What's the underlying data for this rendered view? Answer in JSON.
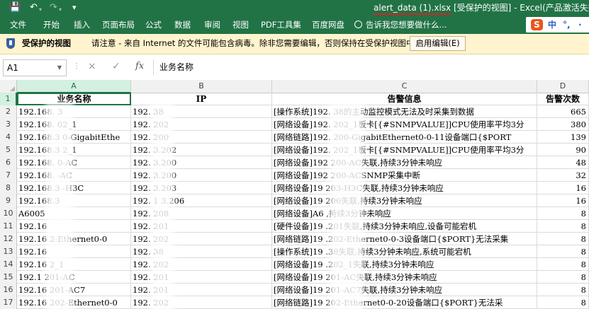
{
  "titlebar": {
    "filename": "alert_data (1).xlsx",
    "suffix": "[受保护的视图] - Excel(产品激活失败)",
    "icons": [
      "save-icon",
      "undo-icon",
      "redo-icon",
      "customize-icon"
    ]
  },
  "ribbon": {
    "tabs": [
      "文件",
      "开始",
      "插入",
      "页面布局",
      "公式",
      "数据",
      "审阅",
      "视图",
      "PDF工具集",
      "百度网盘"
    ],
    "tellme": "告诉我您想要做什么..."
  },
  "ime": {
    "logo": "S",
    "lang": "中",
    "punct": "°,",
    "extra": "·"
  },
  "protected_bar": {
    "title": "受保护的视图",
    "message": "请注意 - 来自 Internet 的文件可能包含病毒。除非您需要编辑，否则保持在受保护视图中比较安全。",
    "button": "启用编辑(E)"
  },
  "formula_bar": {
    "name_box": "A1",
    "fx": "fx",
    "cancel": "×",
    "enter": "✓",
    "formula": "业务名称"
  },
  "columns": [
    "A",
    "B",
    "C",
    "D"
  ],
  "rows": [
    [
      "业务名称",
      "IP",
      "告警信息",
      "告警次数"
    ],
    [
      "192.168.   3",
      "192.     38",
      "[操作系统]192.      38的主动监控模式无法及时采集到数据",
      "665"
    ],
    [
      "192.168.   02_1",
      "192.       202",
      "[网络设备]192.       202_1板卡[{#SNMPVALUE]]CPU使用率平均3分",
      "380"
    ],
    [
      "192.168.3   0-GigabitEthe",
      "192.      200",
      "[网络链路]192.       200-GigabitEthernet0-0-11设备端口{$PORT",
      "139"
    ],
    [
      "192.168.3   2_1",
      "192.     3.202",
      "[网络设备]192.       202_1板卡[{#SNMPVALUE]]CPU使用率平均3分",
      "90"
    ],
    [
      "192.168.   0-AC",
      "192.      3.200",
      "[网络设备]192      200-AC失联,持续3分钟未响应",
      "48"
    ],
    [
      "192.168.   -AC",
      "192.     3.200",
      "[网络设备]192      200-ACSNMP采集中断",
      "32"
    ],
    [
      "192.168.3   -H3C",
      "192.      3.203",
      "[网络设备]19       203-H3C失联,持续3分钟未响应",
      "16"
    ],
    [
      "192.168.3",
      "192. 1   3.206",
      "[网络设备]19       206失联,持续3分钟未响应",
      "16"
    ],
    [
      "A6005",
      "192.     208",
      "[网络设备]A6      ,持续3分钟未响应",
      "8"
    ],
    [
      "192.16",
      "192.     201",
      "[硬件设备]19      .201失联,持续3分钟未响应,设备可能宕机",
      "8"
    ],
    [
      "192.16   2-Ethernet0-0",
      "192.     202",
      "[网络链路]19      .202-Ethernet0-0-3设备端口{$PORT}无法采集",
      "8"
    ],
    [
      "192.16",
      "192.     38",
      "[操作系统]19      .38失联,持续3分钟未响应,系统可能宕机",
      "8"
    ],
    [
      "192.16   2_1",
      "192.     202",
      "[网络设备]19      .202_1失联,持续3分钟未响应",
      "8"
    ],
    [
      "192.1   201-AC",
      "192.     201",
      "[网络设备]19      201-AC失联,持续3分钟未响应",
      "8"
    ],
    [
      "192.16   201-AC7",
      "192.     201",
      "[网络设备]19      201-AC7失联,持续3分钟未响应",
      "8"
    ],
    [
      "192.16   202-Ethernet0-0",
      "192.     202",
      "[网络链路]19       202-Ethernet0-0-20设备端口{$PORT}无法采",
      "8"
    ],
    [
      "",
      "",
      "",
      ""
    ]
  ]
}
